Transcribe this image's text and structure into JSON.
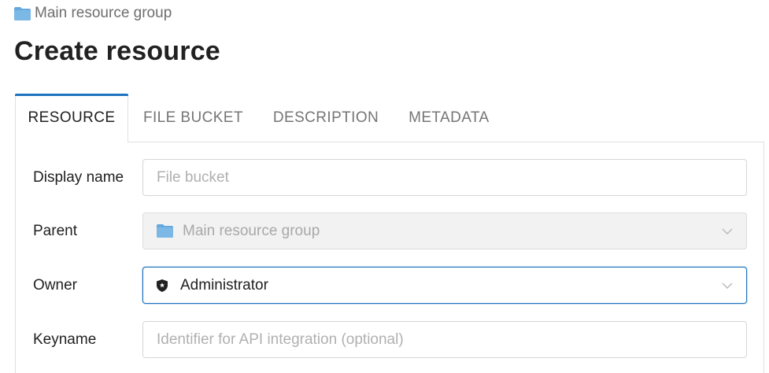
{
  "breadcrumb": {
    "label": "Main resource group",
    "icon": "folder-icon"
  },
  "page": {
    "title": "Create resource"
  },
  "tabs": [
    {
      "label": "RESOURCE",
      "active": true
    },
    {
      "label": "FILE BUCKET",
      "active": false
    },
    {
      "label": "DESCRIPTION",
      "active": false
    },
    {
      "label": "METADATA",
      "active": false
    }
  ],
  "form": {
    "display_name": {
      "label": "Display name",
      "value": "",
      "placeholder": "File bucket"
    },
    "parent": {
      "label": "Parent",
      "value": "Main resource group",
      "icon": "folder-icon",
      "disabled": true
    },
    "owner": {
      "label": "Owner",
      "value": "Administrator",
      "icon": "shield-icon"
    },
    "keyname": {
      "label": "Keyname",
      "value": "",
      "placeholder": "Identifier for API integration (optional)"
    }
  },
  "colors": {
    "accent": "#1e73be",
    "folder": "#64a8de",
    "text": "#212121",
    "muted": "#757575"
  }
}
